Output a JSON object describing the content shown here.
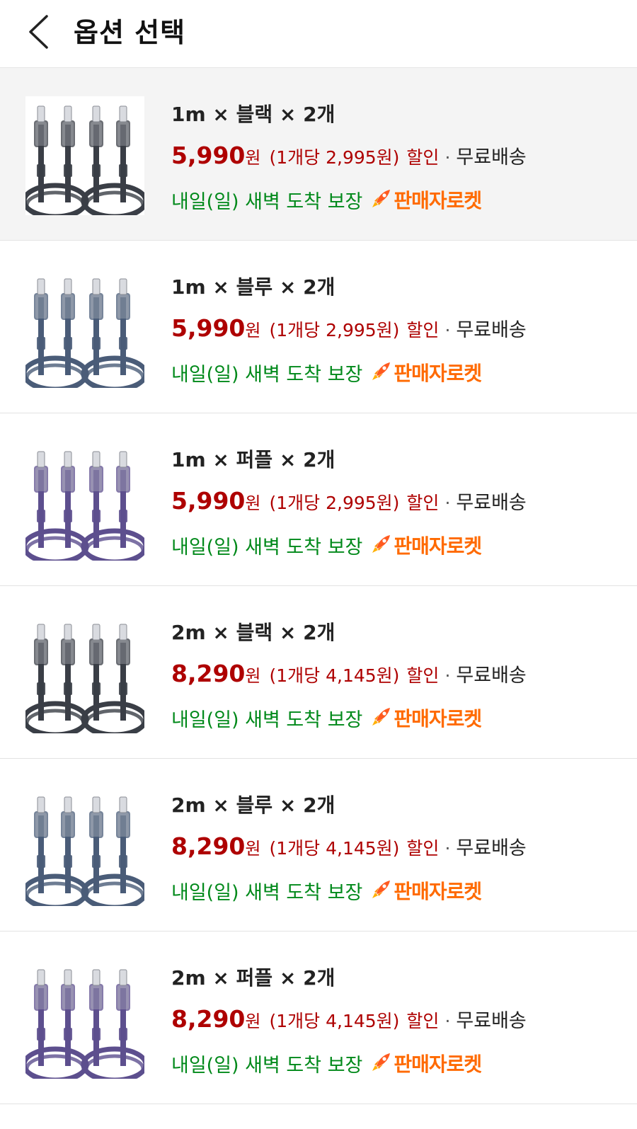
{
  "header": {
    "title": "옵션 선택"
  },
  "options": [
    {
      "name": "1m × 블랙 × 2개",
      "price": "5,990",
      "currency": "원",
      "unit_price": "(1개당 2,995원)",
      "discount": "할인",
      "shipping": "무료배송",
      "arrival": "내일(일) 새벽 도착 보장",
      "badge": "판매자로켓",
      "color": "black",
      "selected": true
    },
    {
      "name": "1m × 블루 × 2개",
      "price": "5,990",
      "currency": "원",
      "unit_price": "(1개당 2,995원)",
      "discount": "할인",
      "shipping": "무료배송",
      "arrival": "내일(일) 새벽 도착 보장",
      "badge": "판매자로켓",
      "color": "blue",
      "selected": false
    },
    {
      "name": "1m × 퍼플 × 2개",
      "price": "5,990",
      "currency": "원",
      "unit_price": "(1개당 2,995원)",
      "discount": "할인",
      "shipping": "무료배송",
      "arrival": "내일(일) 새벽 도착 보장",
      "badge": "판매자로켓",
      "color": "purple",
      "selected": false
    },
    {
      "name": "2m × 블랙 × 2개",
      "price": "8,290",
      "currency": "원",
      "unit_price": "(1개당 4,145원)",
      "discount": "할인",
      "shipping": "무료배송",
      "arrival": "내일(일) 새벽 도착 보장",
      "badge": "판매자로켓",
      "color": "black",
      "selected": false
    },
    {
      "name": "2m × 블루 × 2개",
      "price": "8,290",
      "currency": "원",
      "unit_price": "(1개당 4,145원)",
      "discount": "할인",
      "shipping": "무료배송",
      "arrival": "내일(일) 새벽 도착 보장",
      "badge": "판매자로켓",
      "color": "blue",
      "selected": false
    },
    {
      "name": "2m × 퍼플 × 2개",
      "price": "8,290",
      "currency": "원",
      "unit_price": "(1개당 4,145원)",
      "discount": "할인",
      "shipping": "무료배송",
      "arrival": "내일(일) 새벽 도착 보장",
      "badge": "판매자로켓",
      "color": "purple",
      "selected": false
    }
  ],
  "colors": {
    "price": "#ae0000",
    "arrival": "#00891a",
    "badge": "#ff6a00",
    "selected_bg": "#f4f4f4",
    "cable_black": "#3a3e46",
    "cable_blue": "#4a5c78",
    "cable_purple": "#5d4f8e"
  },
  "icons": {
    "back": "chevron-left-icon",
    "badge": "rocket-icon"
  }
}
